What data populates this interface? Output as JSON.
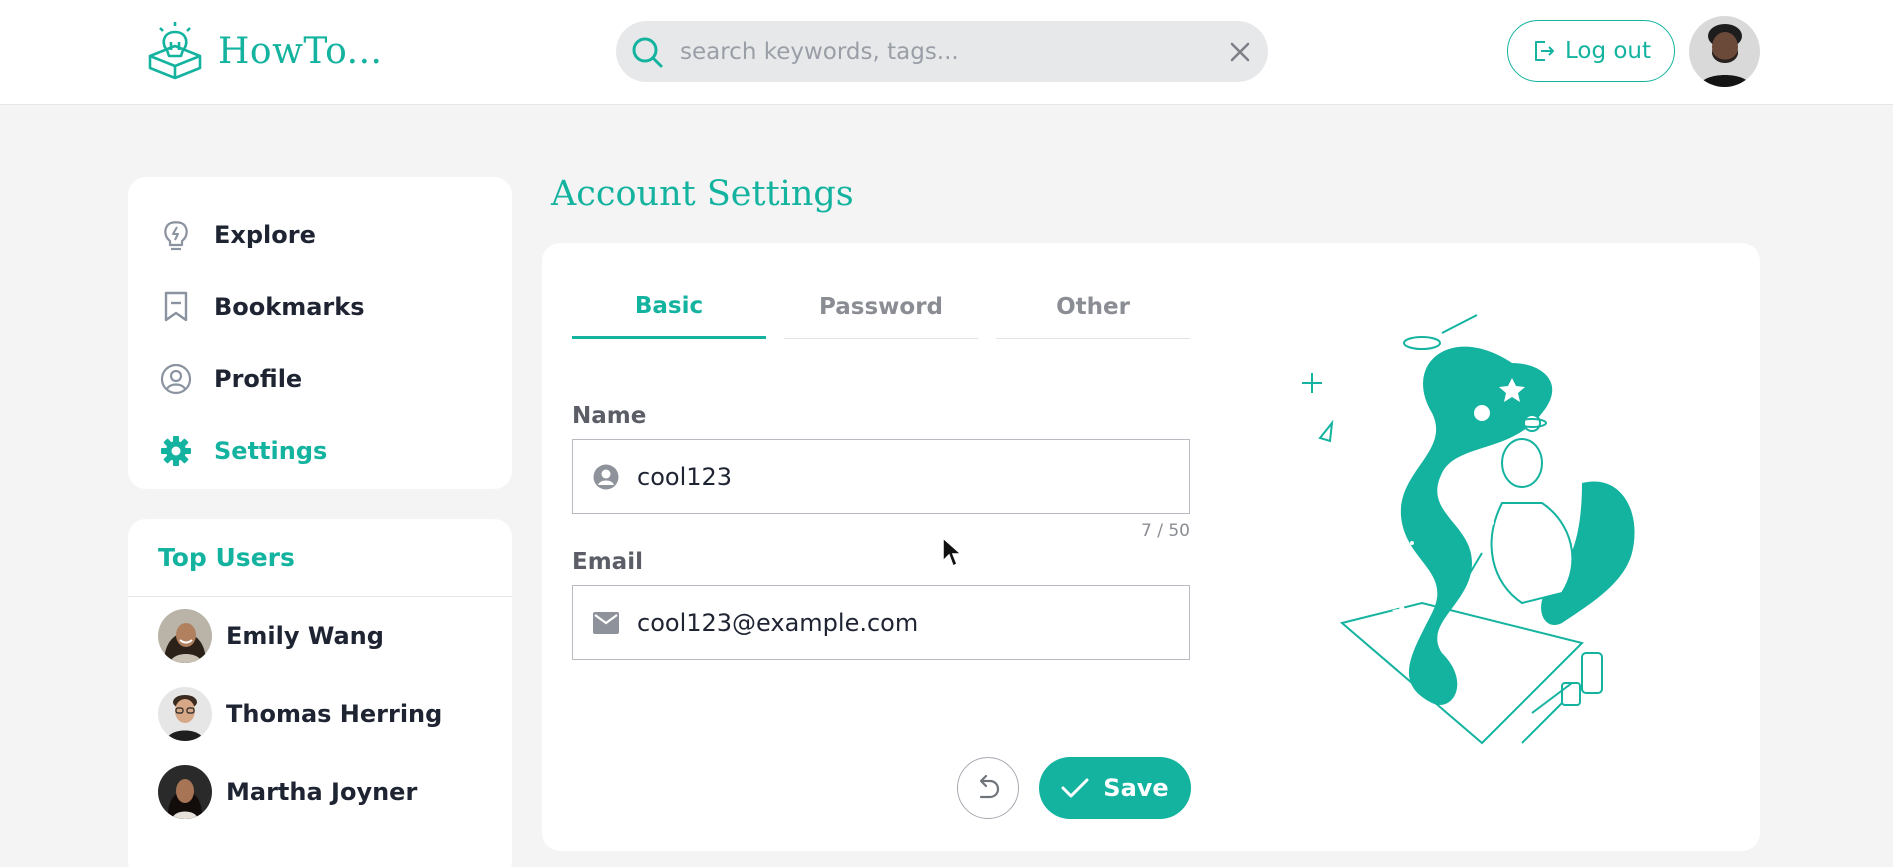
{
  "app": {
    "name": "HowTo..."
  },
  "header": {
    "search_placeholder": "search keywords, tags...",
    "logout_label": "Log out"
  },
  "sidebar": {
    "items": [
      {
        "label": "Explore",
        "icon": "lightbulb-icon"
      },
      {
        "label": "Bookmarks",
        "icon": "bookmark-icon"
      },
      {
        "label": "Profile",
        "icon": "user-circle-icon"
      },
      {
        "label": "Settings",
        "icon": "gear-icon",
        "active": true
      }
    ]
  },
  "top_users": {
    "title": "Top Users",
    "users": [
      {
        "name": "Emily Wang"
      },
      {
        "name": "Thomas Herring"
      },
      {
        "name": "Martha Joyner"
      }
    ]
  },
  "main": {
    "title": "Account Settings",
    "tabs": [
      {
        "label": "Basic",
        "active": true
      },
      {
        "label": "Password"
      },
      {
        "label": "Other"
      }
    ],
    "name_label": "Name",
    "name_value": "cool123",
    "name_counter": "7 / 50",
    "email_label": "Email",
    "email_value": "cool123@example.com",
    "save_label": "Save"
  },
  "colors": {
    "accent": "#14b3a0",
    "background": "#f4f4f4",
    "card": "#ffffff",
    "text": "#1f2433"
  }
}
